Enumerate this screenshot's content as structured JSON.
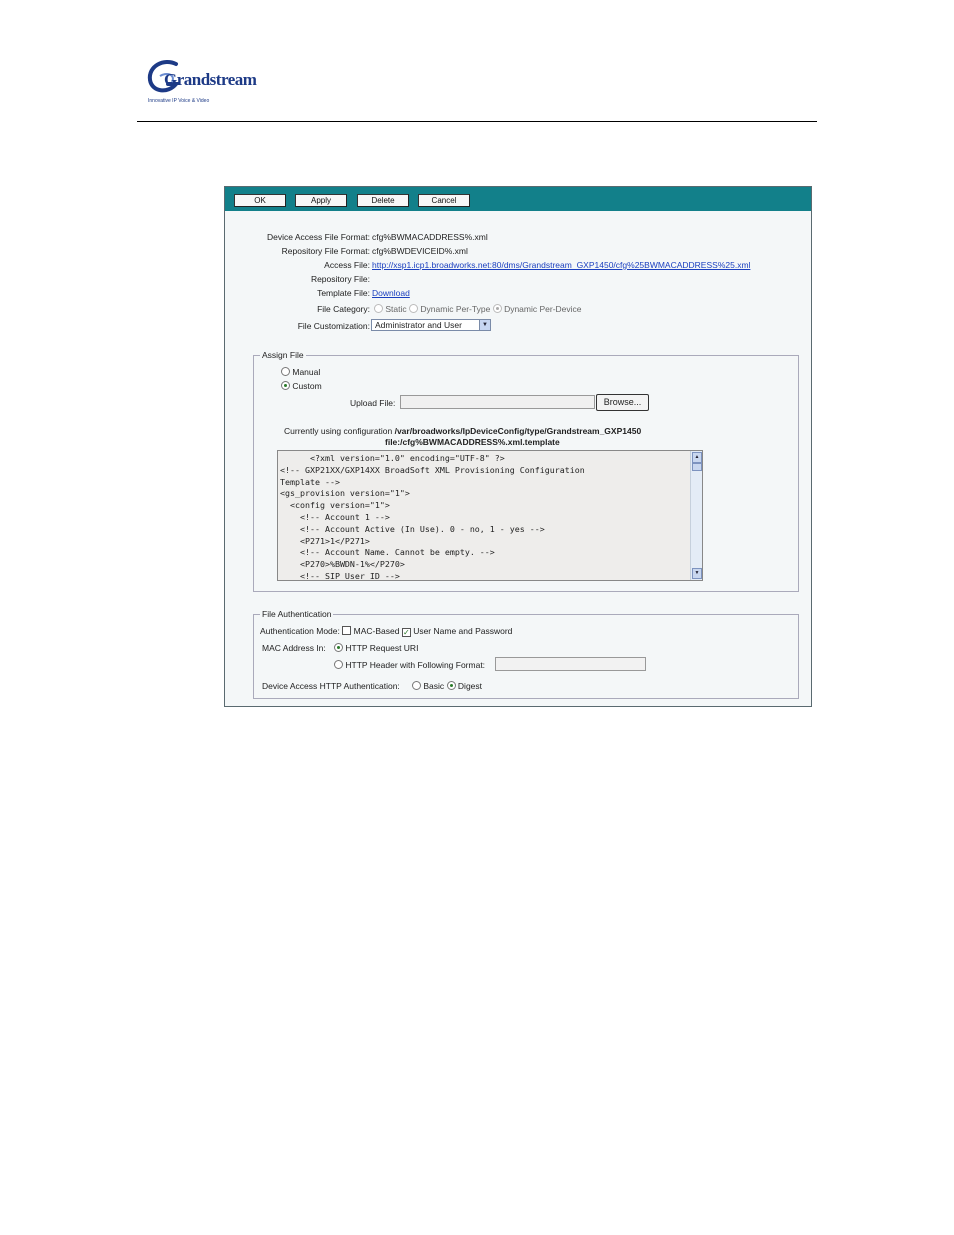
{
  "logo": {
    "brand": "Grandstream",
    "tagline": "Innovative IP Voice & Video"
  },
  "toolbar": {
    "ok": "OK",
    "apply": "Apply",
    "delete": "Delete",
    "cancel": "Cancel"
  },
  "info": {
    "device_access_label": "Device Access File Format:",
    "device_access_value": "cfg%BWMACADDRESS%.xml",
    "repository_format_label": "Repository File Format:",
    "repository_format_value": "cfg%BWDEVICEID%.xml",
    "access_file_label": "Access File:",
    "access_file_value": "http://xsp1.icp1.broadworks.net:80/dms/Grandstream_GXP1450/cfg%25BWMACADDRESS%25.xml",
    "repository_file_label": "Repository File:",
    "template_file_label": "Template File:",
    "template_file_value": "Download",
    "file_category_label": "File Category:",
    "file_category_options": [
      "Static",
      "Dynamic Per-Type",
      "Dynamic Per-Device"
    ],
    "file_category_selected": "Dynamic Per-Device",
    "file_customization_label": "File Customization:",
    "file_customization_value": "Administrator and User"
  },
  "assign": {
    "legend": "Assign File",
    "manual": "Manual",
    "custom": "Custom",
    "selected": "Custom",
    "upload_label": "Upload File:",
    "upload_value": "",
    "browse": "Browse...",
    "currently_prefix": "Currently using configuration",
    "currently_path": "/var/broadworks/IpDeviceConfig/type/Grandstream_GXP1450",
    "currently_file": "file:/cfg%BWMACADDRESS%.xml.template",
    "template_text": "      <?xml version=\"1.0\" encoding=\"UTF-8\" ?>\n<!-- GXP21XX/GXP14XX BroadSoft XML Provisioning Configuration\nTemplate -->\n<gs_provision version=\"1\">\n  <config version=\"1\">\n    <!-- Account 1 -->\n    <!-- Account Active (In Use). 0 - no, 1 - yes -->\n    <P271>1</P271>\n    <!-- Account Name. Cannot be empty. -->\n    <P270>%BWDN-1%</P270>\n    <!-- SIP User ID -->"
  },
  "auth": {
    "legend": "File Authentication",
    "mode_label": "Authentication Mode:",
    "mac_based": "MAC-Based",
    "mac_based_checked": false,
    "user_pass": "User Name and Password",
    "user_pass_checked": true,
    "mac_in_label": "MAC Address In:",
    "http_uri": "HTTP Request URI",
    "http_header": "HTTP Header with Following Format:",
    "mac_in_selected": "HTTP Request URI",
    "header_value": "",
    "http_auth_label": "Device Access HTTP Authentication:",
    "basic": "Basic",
    "digest": "Digest",
    "http_auth_selected": "Digest"
  }
}
